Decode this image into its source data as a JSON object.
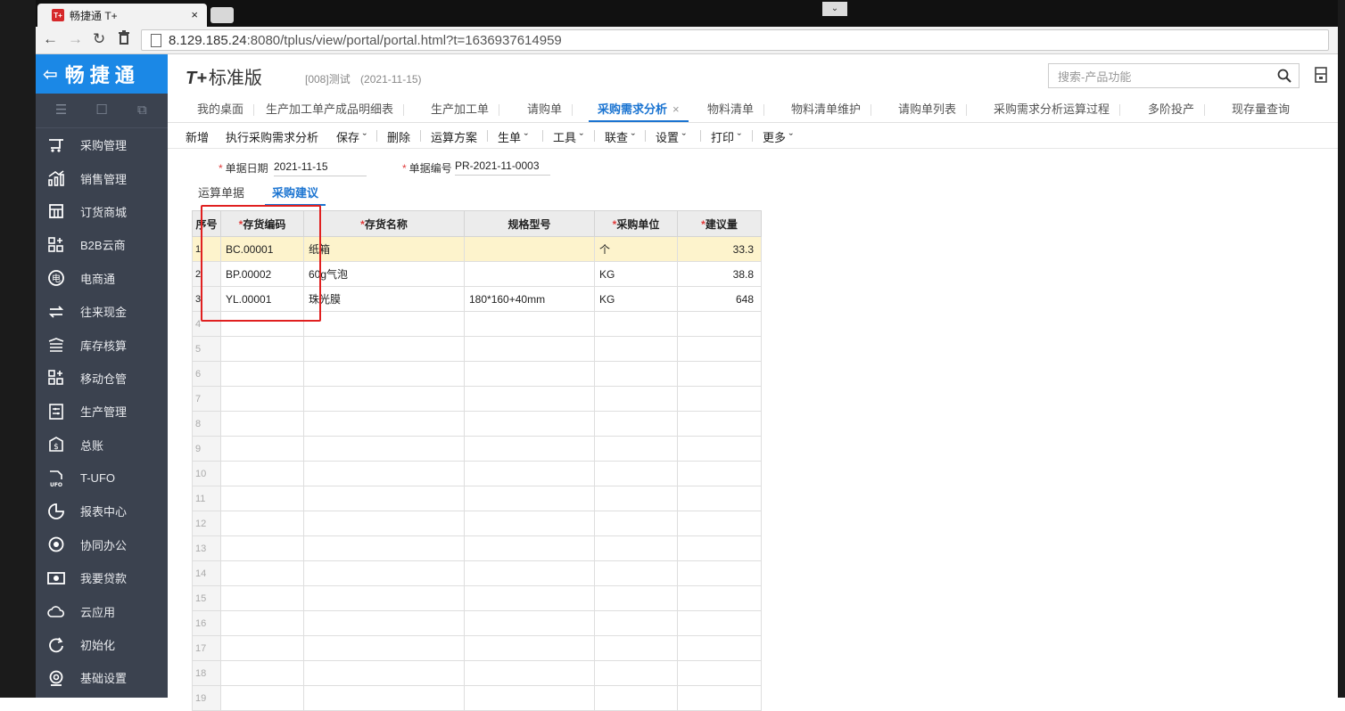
{
  "browser": {
    "tab_title": "畅捷通 T+",
    "tab_close": "×",
    "favicon_text": "T+",
    "url_host": "8.129.185.24",
    "url_rest": ":8080/tplus/view/portal/portal.html?t=1636937614959"
  },
  "brand": {
    "name": "畅捷通"
  },
  "header": {
    "product": "T+",
    "edition": "标准版",
    "account": "[008]测试",
    "date": "(2021-11-15)",
    "search_placeholder": "搜索-产品功能"
  },
  "sidebar": {
    "items": [
      {
        "label": "采购管理",
        "icon": "purchase-icon"
      },
      {
        "label": "销售管理",
        "icon": "sales-chart-icon"
      },
      {
        "label": "订货商城",
        "icon": "store-icon"
      },
      {
        "label": "B2B云商",
        "icon": "b2b-icon"
      },
      {
        "label": "电商通",
        "icon": "ecommerce-icon"
      },
      {
        "label": "往来现金",
        "icon": "exchange-icon"
      },
      {
        "label": "库存核算",
        "icon": "inventory-icon"
      },
      {
        "label": "移动仓管",
        "icon": "mobile-warehouse-icon"
      },
      {
        "label": "生产管理",
        "icon": "production-icon"
      },
      {
        "label": "总账",
        "icon": "ledger-icon"
      },
      {
        "label": "T-UFO",
        "icon": "ufo-icon"
      },
      {
        "label": "报表中心",
        "icon": "report-icon"
      },
      {
        "label": "协同办公",
        "icon": "collaboration-icon"
      },
      {
        "label": "我要贷款",
        "icon": "loan-icon"
      },
      {
        "label": "云应用",
        "icon": "cloud-icon"
      },
      {
        "label": "初始化",
        "icon": "init-icon"
      },
      {
        "label": "基础设置",
        "icon": "settings-icon"
      }
    ]
  },
  "function_tabs": [
    "我的桌面",
    "生产加工单产成品明细表",
    "生产加工单",
    "请购单",
    "采购需求分析",
    "物料清单",
    "物料清单维护",
    "请购单列表",
    "采购需求分析运算过程",
    "多阶投产",
    "现存量查询"
  ],
  "active_tab_close": "×",
  "toolbar": {
    "new": "新增",
    "execute": "执行采购需求分析",
    "save": "保存",
    "delete": "删除",
    "plan": "运算方案",
    "generate": "生单",
    "tools": "工具",
    "link": "联查",
    "settings": "设置",
    "print": "打印",
    "more": "更多"
  },
  "form": {
    "date_label": "单据日期",
    "date_value": "2021-11-15",
    "code_label": "单据编号",
    "code_value": "PR-2021-11-0003"
  },
  "subtabs": {
    "calc": "运算单据",
    "suggest": "采购建议"
  },
  "grid": {
    "headers": {
      "seq": "序号",
      "code": "存货编码",
      "name": "存货名称",
      "spec": "规格型号",
      "unit": "采购单位",
      "qty": "建议量"
    },
    "rows": [
      {
        "seq": "1",
        "code": "BC.00001",
        "name": "纸箱",
        "spec": "",
        "unit": "个",
        "qty": "33.3"
      },
      {
        "seq": "2",
        "code": "BP.00002",
        "name": "60g气泡",
        "spec": "",
        "unit": "KG",
        "qty": "38.8"
      },
      {
        "seq": "3",
        "code": "YL.00001",
        "name": "珠光膜",
        "spec": "180*160+40mm",
        "unit": "KG",
        "qty": "648"
      }
    ],
    "empty_row_numbers": [
      "4",
      "5",
      "6",
      "7",
      "8",
      "9",
      "10",
      "11",
      "12",
      "13",
      "14",
      "15",
      "16",
      "17",
      "18",
      "19"
    ]
  }
}
